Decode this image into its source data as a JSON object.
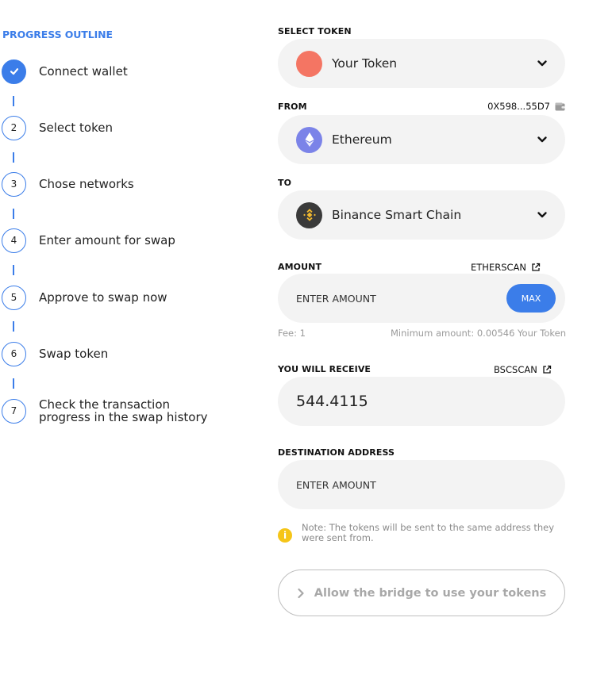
{
  "progress": {
    "title": "PROGRESS OUTLINE",
    "steps": [
      {
        "num": "",
        "label": "Connect wallet",
        "done": true
      },
      {
        "num": "2",
        "label": "Select token"
      },
      {
        "num": "3",
        "label": "Chose networks"
      },
      {
        "num": "4",
        "label": "Enter amount for swap"
      },
      {
        "num": "5",
        "label": "Approve to swap now"
      },
      {
        "num": "6",
        "label": "Swap token"
      },
      {
        "num": "7",
        "label": "Check the transaction progress in the swap history"
      }
    ]
  },
  "form": {
    "select_token": {
      "label": "SELECT TOKEN",
      "value": "Your Token",
      "icon_color": "#f47563"
    },
    "from": {
      "label": "FROM",
      "address": "0X598...55D7",
      "value": "Ethereum",
      "icon_color": "#7b83e8"
    },
    "to": {
      "label": "TO",
      "value": "Binance Smart Chain",
      "icon_color": "#3a3a3a",
      "icon_accent": "#f3ba2f"
    },
    "amount": {
      "label": "AMOUNT",
      "explorer_link": "ETHERSCAN",
      "placeholder": "ENTER AMOUNT",
      "max_label": "MAX",
      "fee": "Fee: 1",
      "minimum": "Minimum amount: 0.00546 Your Token"
    },
    "receive": {
      "label": "YOU WILL RECEIVE",
      "explorer_link": "BSCSCAN",
      "value": "544.4115"
    },
    "destination": {
      "label": "DESTINATION ADDRESS",
      "placeholder": "ENTER AMOUNT"
    },
    "note": "Note: The tokens will be sent to the same address they were sent from.",
    "submit_label": "Allow the bridge to use your tokens"
  },
  "colors": {
    "accent": "#3b7de9",
    "note": "#f5c518"
  }
}
